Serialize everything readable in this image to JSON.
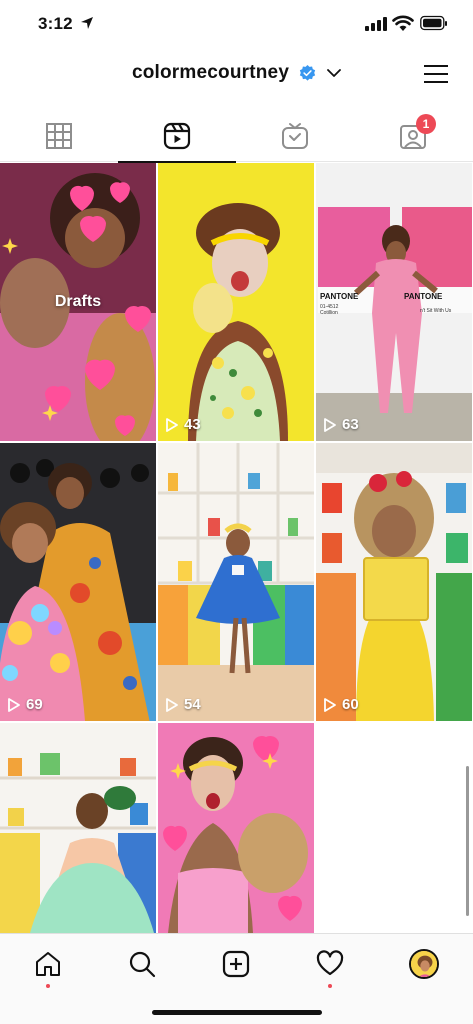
{
  "status_bar": {
    "time": "3:12"
  },
  "header": {
    "username": "colormecourtney",
    "verified": true
  },
  "tabs": [
    {
      "name": "grid",
      "icon": "grid-icon",
      "active": false
    },
    {
      "name": "reels",
      "icon": "reels-icon",
      "active": true
    },
    {
      "name": "igtv",
      "icon": "igtv-icon",
      "active": false
    },
    {
      "name": "tagged",
      "icon": "tagged-icon",
      "active": false,
      "badge": "1"
    }
  ],
  "reels": [
    {
      "label": "Drafts",
      "count": ""
    },
    {
      "label": "",
      "count": "43"
    },
    {
      "label": "",
      "count": "63"
    },
    {
      "label": "",
      "count": "69"
    },
    {
      "label": "",
      "count": "54"
    },
    {
      "label": "",
      "count": "60"
    },
    {
      "label": "",
      "count": ""
    },
    {
      "label": "",
      "count": ""
    }
  ],
  "pantone_text": {
    "left": "PANTONE",
    "left_code": "01-4512",
    "left_name": "Cotillion",
    "right": "PANTONE",
    "right_name": "n't Sit With Us"
  },
  "bottom_nav": [
    {
      "name": "home",
      "icon": "home-icon"
    },
    {
      "name": "search",
      "icon": "search-icon"
    },
    {
      "name": "create",
      "icon": "plus-square-icon"
    },
    {
      "name": "activity",
      "icon": "heart-icon"
    },
    {
      "name": "profile",
      "icon": "avatar"
    }
  ],
  "colors": {
    "accent_red": "#ed4956",
    "verified_blue": "#3897f0"
  }
}
